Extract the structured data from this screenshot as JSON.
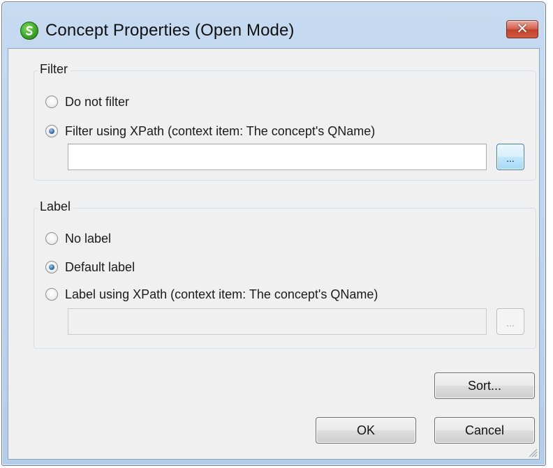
{
  "window": {
    "title": "Concept Properties (Open Mode)",
    "app_icon": "altova-s-icon",
    "close_label": "✕"
  },
  "filter": {
    "legend": "Filter",
    "options": [
      {
        "label": "Do not filter",
        "checked": false
      },
      {
        "label": "Filter using XPath (context item: The concept's QName)",
        "checked": true
      }
    ],
    "xpath_value": "",
    "browse_label": "..."
  },
  "label": {
    "legend": "Label",
    "options": [
      {
        "label": "No label",
        "checked": false
      },
      {
        "label": "Default label",
        "checked": true
      },
      {
        "label": "Label using XPath (context item: The concept's QName)",
        "checked": false
      }
    ],
    "xpath_value": "",
    "xpath_enabled": false,
    "browse_label": "..."
  },
  "buttons": {
    "sort": "Sort...",
    "ok": "OK",
    "cancel": "Cancel"
  },
  "colors": {
    "titlebar": "#bcd3ec",
    "client": "#f0f0f0",
    "close": "#c2412b",
    "focus": "#3c7fb1"
  }
}
